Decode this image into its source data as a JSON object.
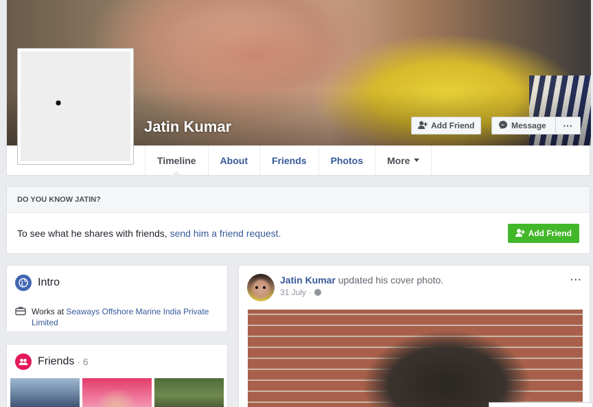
{
  "profile": {
    "name": "Jatin Kumar",
    "buttons": {
      "add_friend": "Add Friend",
      "message": "Message",
      "more": "···"
    }
  },
  "tabs": [
    {
      "label": "Timeline"
    },
    {
      "label": "About"
    },
    {
      "label": "Friends"
    },
    {
      "label": "Photos"
    },
    {
      "label": "More"
    }
  ],
  "know": {
    "title": "DO YOU KNOW JATIN?",
    "text_prefix": "To see what he shares with friends, ",
    "link": "send him a friend request.",
    "button": "Add Friend"
  },
  "intro": {
    "title": "Intro",
    "works_prefix": "Works at ",
    "employer": "Seaways Offshore Marine India Private Limited"
  },
  "friends": {
    "title": "Friends",
    "count": "· 6"
  },
  "post": {
    "author": "Jatin Kumar",
    "action": " updated his cover photo.",
    "date": "31 July",
    "separator": "·",
    "menu": "···"
  },
  "colors": {
    "link": "#365899",
    "green": "#42b72a",
    "background": "#e9ebee"
  }
}
